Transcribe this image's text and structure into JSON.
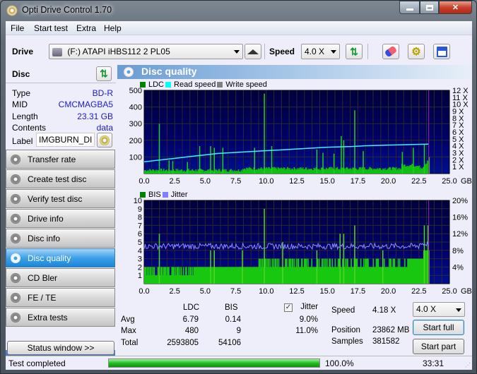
{
  "window": {
    "title": "Opti Drive Control 1.70",
    "minimize": "—",
    "maximize": "□",
    "close": "✕"
  },
  "menu": [
    "File",
    "Start test",
    "Extra",
    "Help"
  ],
  "toolbar": {
    "drive_label": "Drive",
    "drive_value": "(F:)   ATAPI iHBS112   2 PL05",
    "speed_label": "Speed",
    "speed_value": "4.0 X",
    "icons": [
      "eject-icon",
      "refresh-icon",
      "erase-icon",
      "settings-icon",
      "save-icon"
    ]
  },
  "disc": {
    "header": "Disc",
    "rows": [
      {
        "label": "Type",
        "value": "BD-R"
      },
      {
        "label": "MID",
        "value": "CMCMAGBA5"
      },
      {
        "label": "Length",
        "value": "23.31 GB"
      },
      {
        "label": "Contents",
        "value": "data"
      }
    ],
    "label_label": "Label",
    "label_value": "IMGBURN_DIS"
  },
  "nav": [
    {
      "label": "Transfer rate",
      "active": false
    },
    {
      "label": "Create test disc",
      "active": false
    },
    {
      "label": "Verify test disc",
      "active": false
    },
    {
      "label": "Drive info",
      "active": false
    },
    {
      "label": "Disc info",
      "active": false
    },
    {
      "label": "Disc quality",
      "active": true
    },
    {
      "label": "CD Bler",
      "active": false
    },
    {
      "label": "FE / TE",
      "active": false
    },
    {
      "label": "Extra tests",
      "active": false
    }
  ],
  "status_window_button": "Status window >>",
  "panel": {
    "title": "Disc quality"
  },
  "chart_data": [
    {
      "type": "bar",
      "title": "LDC",
      "legend": [
        "LDC",
        "Read speed",
        "Write speed"
      ],
      "legend_colors": [
        "#008000",
        "#00ffff",
        "#808080"
      ],
      "xlabel": "GB",
      "xlim": [
        0,
        25
      ],
      "x_ticks": [
        "0.0",
        "2.5",
        "5.0",
        "7.5",
        "10.0",
        "12.5",
        "15.0",
        "17.5",
        "20.0",
        "22.5",
        "25.0"
      ],
      "ylim": [
        0,
        500
      ],
      "y_ticks": [
        "100",
        "200",
        "300",
        "400",
        "500"
      ],
      "y2lim": [
        0,
        12
      ],
      "y2_ticks": [
        "1 X",
        "2 X",
        "3 X",
        "4 X",
        "5 X",
        "6 X",
        "7 X",
        "8 X",
        "9 X",
        "10 X",
        "11 X",
        "12 X"
      ],
      "grid": true,
      "ldc_spikes": [
        [
          1.2,
          300
        ],
        [
          2.0,
          80
        ],
        [
          2.3,
          75
        ],
        [
          3.5,
          70
        ],
        [
          4.5,
          165
        ],
        [
          5.4,
          165
        ],
        [
          5.7,
          155
        ],
        [
          6.4,
          155
        ],
        [
          9.0,
          155
        ],
        [
          9.8,
          480
        ],
        [
          10.4,
          165
        ],
        [
          14.1,
          145
        ],
        [
          14.6,
          125
        ],
        [
          15.5,
          120
        ],
        [
          16.1,
          225
        ],
        [
          16.3,
          200
        ],
        [
          17.2,
          380
        ],
        [
          17.9,
          135
        ],
        [
          21.1,
          130
        ],
        [
          22.0,
          155
        ],
        [
          22.9,
          175
        ],
        [
          23.3,
          100
        ]
      ],
      "ldc_baseline": 20,
      "read_speed": [
        [
          0,
          1.7
        ],
        [
          1.0,
          1.9
        ],
        [
          2.0,
          2.1
        ],
        [
          3.0,
          2.3
        ],
        [
          4.0,
          2.5
        ],
        [
          5.0,
          2.7
        ],
        [
          6.0,
          2.9
        ],
        [
          7.0,
          3.0
        ],
        [
          8.0,
          3.1
        ],
        [
          9.0,
          3.2
        ],
        [
          10.0,
          3.3
        ],
        [
          11.0,
          3.4
        ],
        [
          12.0,
          3.5
        ],
        [
          13.0,
          3.6
        ],
        [
          14.0,
          3.7
        ],
        [
          15.0,
          3.8
        ],
        [
          16.0,
          3.85
        ],
        [
          17.0,
          3.9
        ],
        [
          18.0,
          4.0
        ],
        [
          19.0,
          4.05
        ],
        [
          20.0,
          4.1
        ],
        [
          21.0,
          4.15
        ],
        [
          22.0,
          4.2
        ],
        [
          23.3,
          4.25
        ]
      ],
      "end_marker": 23.3
    },
    {
      "type": "bar",
      "title": "BIS",
      "legend": [
        "BIS",
        "Jitter"
      ],
      "legend_colors": [
        "#008000",
        "#8080ff"
      ],
      "xlabel": "GB",
      "xlim": [
        0,
        25
      ],
      "x_ticks": [
        "0.0",
        "2.5",
        "5.0",
        "7.5",
        "10.0",
        "12.5",
        "15.0",
        "17.5",
        "20.0",
        "22.5",
        "25.0"
      ],
      "ylim": [
        0,
        10
      ],
      "y_ticks": [
        "1",
        "2",
        "3",
        "4",
        "5",
        "6",
        "7",
        "8",
        "9",
        "10"
      ],
      "y2lim": [
        0,
        20
      ],
      "y2_ticks": [
        "4%",
        "8%",
        "12%",
        "16%",
        "20%"
      ],
      "grid": true,
      "bis_spikes": [
        [
          1.2,
          6
        ],
        [
          5.4,
          4
        ],
        [
          5.7,
          4
        ],
        [
          8.0,
          4
        ],
        [
          9.8,
          9
        ],
        [
          11.3,
          5
        ],
        [
          14.1,
          4
        ],
        [
          16.0,
          6
        ],
        [
          16.3,
          6
        ],
        [
          17.2,
          7
        ],
        [
          19.5,
          4
        ],
        [
          22.9,
          7
        ],
        [
          23.2,
          7
        ]
      ],
      "bis_level": 2,
      "jitter_avg_pct": 9.0,
      "end_marker": 23.3
    }
  ],
  "stats": {
    "col_ldc": "LDC",
    "col_bis": "BIS",
    "jitter_label": "Jitter",
    "jitter_checked": true,
    "rows": [
      {
        "label": "Avg",
        "ldc": "6.79",
        "bis": "0.14",
        "jitter": "9.0%"
      },
      {
        "label": "Max",
        "ldc": "480",
        "bis": "9",
        "jitter": "11.0%"
      },
      {
        "label": "Total",
        "ldc": "2593805",
        "bis": "54106",
        "jitter": ""
      }
    ],
    "speed_label": "Speed",
    "speed_value": "4.18 X",
    "position_label": "Position",
    "position_value": "23862 MB",
    "samples_label": "Samples",
    "samples_value": "381582",
    "speed_select": "4.0 X",
    "start_full": "Start full",
    "start_part": "Start part"
  },
  "statusbar": {
    "text": "Test completed",
    "progress": 1.0,
    "progress_text": "100.0%",
    "time": "33:31"
  }
}
